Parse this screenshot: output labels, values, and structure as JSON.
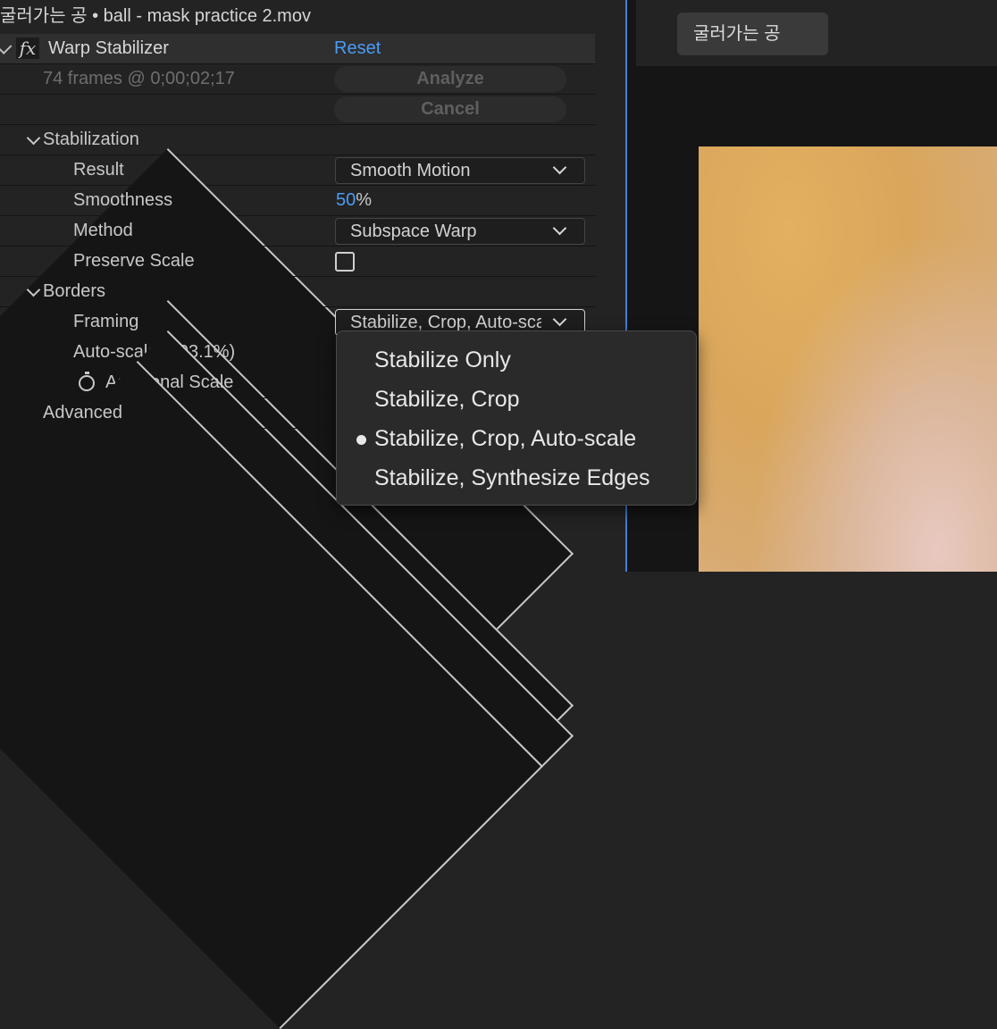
{
  "panel": {
    "title": "굴러가는 공 • ball - mask practice 2.mov",
    "effect_name": "Warp Stabilizer",
    "fx_label": "fx",
    "reset": "Reset",
    "frames_info": "74 frames @ 0;00;02;17",
    "analyze": "Analyze",
    "cancel": "Cancel",
    "stabilization": "Stabilization",
    "result_label": "Result",
    "result_value": "Smooth Motion",
    "smoothness_label": "Smoothness",
    "smoothness_value": "50",
    "smoothness_unit": "%",
    "method_label": "Method",
    "method_value": "Subspace Warp",
    "preserve_scale_label": "Preserve Scale",
    "preserve_scale_checked": false,
    "borders": "Borders",
    "framing_label": "Framing",
    "framing_value": "Stabilize, Crop, Auto-scale",
    "autoscale_label": "Auto-scale (103.1%)",
    "additional_scale_label": "Additional Scale",
    "advanced": "Advanced"
  },
  "viewer": {
    "tab_label": "굴러가는 공"
  },
  "menu": {
    "items": [
      {
        "label": "Stabilize Only",
        "selected": false
      },
      {
        "label": "Stabilize, Crop",
        "selected": false
      },
      {
        "label": "Stabilize, Crop, Auto-scale",
        "selected": true
      },
      {
        "label": "Stabilize, Synthesize Edges",
        "selected": false
      }
    ]
  },
  "colors": {
    "accent_blue": "#4a9cf5",
    "panel_bg": "#232323"
  }
}
